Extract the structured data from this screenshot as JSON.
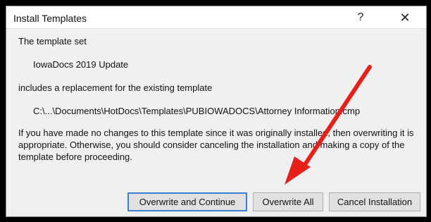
{
  "dialog": {
    "title": "Install Templates",
    "help_glyph": "?",
    "close_glyph": "✕",
    "line1": "The template set",
    "template_set_name": "IowaDocs 2019 Update",
    "line3": "includes a replacement for the existing template",
    "template_path": "C:\\...\\Documents\\HotDocs\\Templates\\PUBIOWADOCS\\Attorney Information.cmp",
    "message": "If you have made no changes to this template since it was originally installed, then overwriting it is appropriate. Otherwise, you should consider canceling the installation and making a copy of the template before proceeding."
  },
  "buttons": {
    "overwrite_continue": "Overwrite and Continue",
    "overwrite_all": "Overwrite All",
    "cancel_installation": "Cancel Installation"
  },
  "annotation": {
    "arrow_color": "#e8201a",
    "icon": "red-arrow-annotation-icon"
  },
  "colors": {
    "dialog_bg": "#f0f0f0",
    "titlebar_bg": "#ffffff",
    "default_button_border": "#3c7fd4"
  }
}
